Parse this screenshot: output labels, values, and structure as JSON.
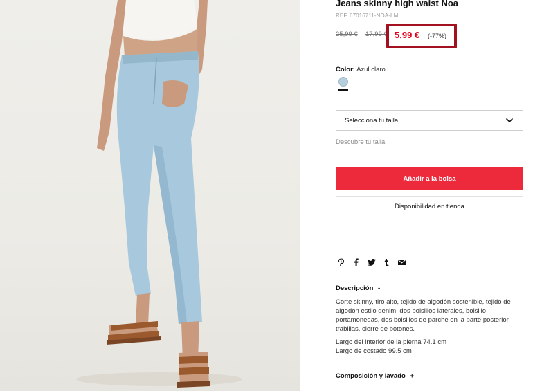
{
  "product": {
    "title": "Jeans skinny high waist Noa",
    "ref": "REF. 67016711-NOA-LM",
    "old_price_1": "25,99 €",
    "old_price_2": "17,99 €",
    "current_price": "5,99 €",
    "discount": "(-77%)"
  },
  "color": {
    "label": "Color:",
    "value": "Azul claro",
    "swatch_hex": "#b5cfde"
  },
  "size": {
    "select_label": "Selecciona tu talla",
    "guide_link": "Descubre tu talla"
  },
  "actions": {
    "add_to_bag": "Añadir a la bolsa",
    "store_availability": "Disponibilidad en tienda"
  },
  "share_icons": [
    "pinterest-icon",
    "facebook-icon",
    "twitter-icon",
    "tumblr-icon",
    "email-icon"
  ],
  "description": {
    "title": "Descripción",
    "toggle": "-",
    "body": "Corte skinny, tiro alto, tejido de algodón sostenible, tejido de algodón estilo denim, dos bolsillos laterales, bolsillo portamonedas, dos bolsillos de parche en la parte posterior, trabillas, cierre de botones.",
    "measure_1": "Largo del interior de la pierna 74.1 cm",
    "measure_2": "Largo de costado 99.5 cm"
  },
  "composition": {
    "title": "Composición y lavado",
    "toggle": "+"
  },
  "colors": {
    "accent_red": "#ec2a3c",
    "price_red": "#e2001a",
    "highlight_border": "#a3101f"
  }
}
